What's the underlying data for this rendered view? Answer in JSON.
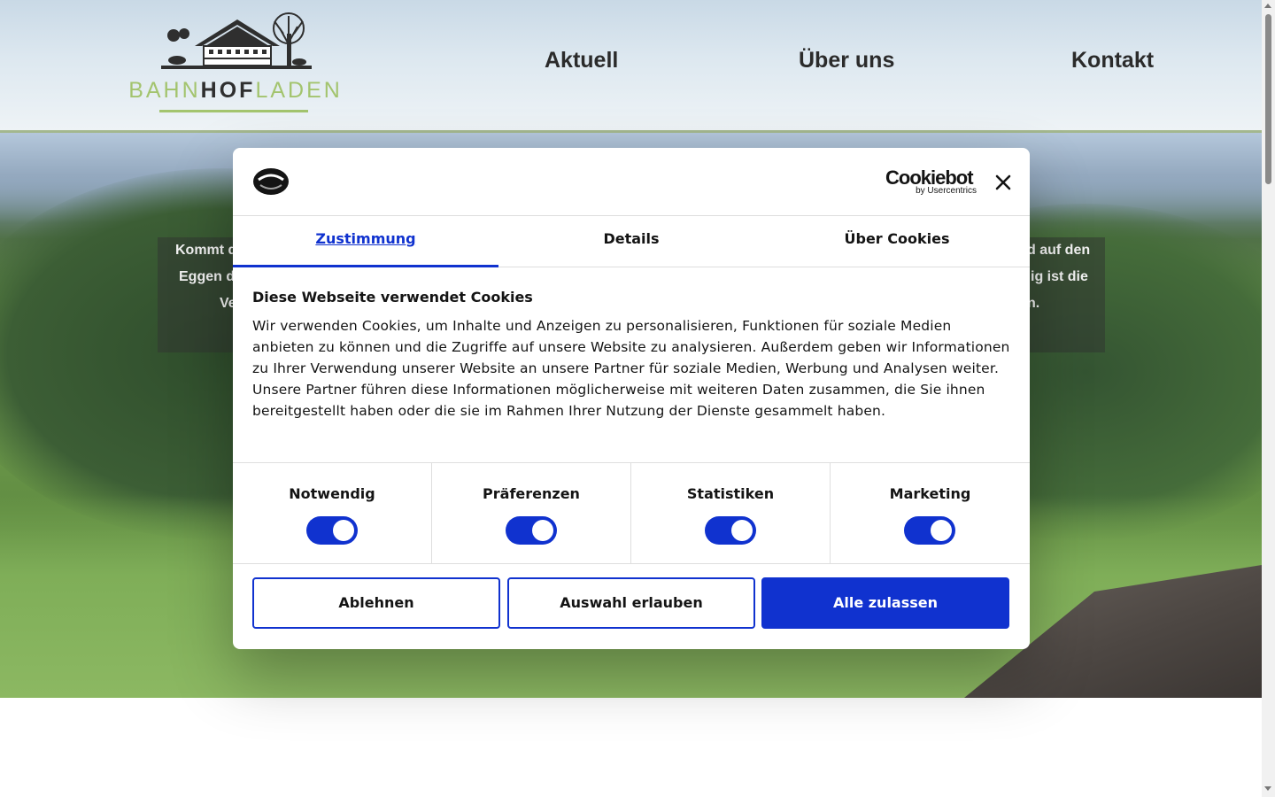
{
  "site": {
    "logo_text_light_1": "BAHN",
    "logo_text_bold": "HOF",
    "logo_text_light_2": "LADEN",
    "nav": [
      {
        "label": "Aktuell"
      },
      {
        "label": "Über uns"
      },
      {
        "label": "Kontakt"
      }
    ]
  },
  "hero": {
    "line1_left": "Kommt d",
    "line2_left": "Eggen de",
    "line3_left": "Ve",
    "line1_right": "d auf den",
    "line2_right": "ig ist die",
    "line3_right": "n."
  },
  "cookie_dialog": {
    "brand_name": "Cookiebot",
    "brand_sub": "by Usercentrics",
    "tabs": [
      {
        "label": "Zustimmung",
        "active": true
      },
      {
        "label": "Details",
        "active": false
      },
      {
        "label": "Über Cookies",
        "active": false
      }
    ],
    "title": "Diese Webseite verwendet Cookies",
    "body": "Wir verwenden Cookies, um Inhalte und Anzeigen zu personalisieren, Funktionen für soziale Medien anbieten zu können und die Zugriffe auf unsere Website zu analysieren. Außerdem geben wir Informationen zu Ihrer Verwendung unserer Website an unsere Partner für soziale Medien, Werbung und Analysen weiter. Unsere Partner führen diese Informationen möglicherweise mit weiteren Daten zusammen, die Sie ihnen bereitgestellt haben oder die sie im Rahmen Ihrer Nutzung der Dienste gesammelt haben.",
    "categories": [
      {
        "label": "Notwendig",
        "enabled": true
      },
      {
        "label": "Präferenzen",
        "enabled": true
      },
      {
        "label": "Statistiken",
        "enabled": true
      },
      {
        "label": "Marketing",
        "enabled": true
      }
    ],
    "buttons": {
      "reject": "Ablehnen",
      "allow_selection": "Auswahl erlauben",
      "allow_all": "Alle zulassen"
    },
    "accent_color": "#1032cf"
  }
}
